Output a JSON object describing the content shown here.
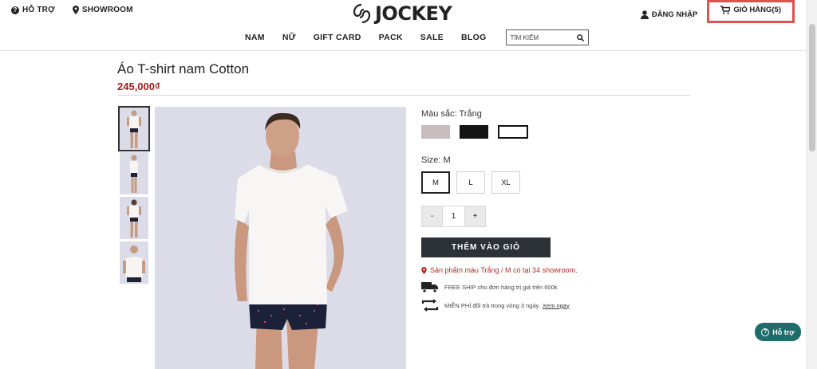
{
  "header": {
    "support_label": "HỖ TRỢ",
    "showroom_label": "SHOWROOM",
    "logo_text": "JOCKEY",
    "login_label": "ĐĂNG NHẬP",
    "cart_label": "GIỎ HÀNG(5)"
  },
  "nav": {
    "items": [
      "NAM",
      "NỮ",
      "GIFT CARD",
      "PACK",
      "SALE",
      "BLOG"
    ],
    "search_placeholder": "TÌM KIẾM"
  },
  "product": {
    "title": "Áo T-shirt nam Cotton",
    "price": "245,000₫",
    "color_label": "Màu sắc: Trắng",
    "colors": [
      "#c9bcbc",
      "#141414",
      "#ffffff"
    ],
    "selected_color_index": 2,
    "size_label": "Size: M",
    "sizes": [
      "M",
      "L",
      "XL"
    ],
    "selected_size": "M",
    "qty_minus": "-",
    "qty_value": "1",
    "qty_plus": "+",
    "add_to_cart": "THÊM VÀO GIỎ",
    "availability": "Sản phẩm màu Trắng / M có tại 34 showroom.",
    "free_ship": "FREE SHIP cho đơn hàng trị giá trên 600k",
    "free_return": "MIỄN PHÍ đổi trả trong vòng 3 ngày.",
    "see_now": "Xem ngay"
  },
  "help_button": "Hỗ trợ",
  "colors": {
    "price": "#9e1b1b",
    "button_dark": "#2d3238",
    "help_bg": "#1d6d6a",
    "cart_highlight": "#e05050"
  }
}
